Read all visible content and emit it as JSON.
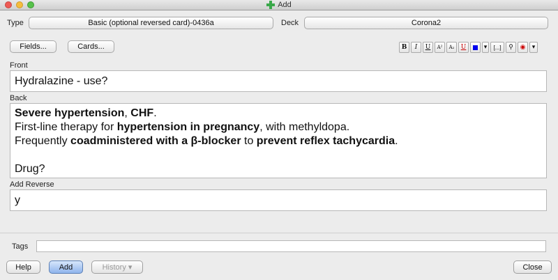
{
  "window": {
    "title": "Add"
  },
  "header": {
    "type_label": "Type",
    "type_value": "Basic (optional reversed card)-0436a",
    "deck_label": "Deck",
    "deck_value": "Corona2"
  },
  "buttons": {
    "fields": "Fields...",
    "cards": "Cards..."
  },
  "toolbar": {
    "bold": "B",
    "italic": "I",
    "underline": "U",
    "superscript": "A²",
    "subscript": "A₂",
    "clear_format": "U",
    "color_arrow": "▾",
    "cloze": "[...]",
    "attach": "⚲",
    "record": "◉",
    "more": "▾",
    "text_color": "#0000ee"
  },
  "fields": {
    "front": {
      "label": "Front",
      "value": "Hydralazine - use?"
    },
    "back": {
      "label": "Back",
      "line1_b1": "Severe hypertension",
      "line1_t1": ", ",
      "line1_b2": "CHF",
      "line1_t2": ".",
      "line2_t1": "First-line therapy for ",
      "line2_b1": "hypertension in pregnancy",
      "line2_t2": ", with methyldopa.",
      "line3_t1": "Frequently ",
      "line3_b1": "coadministered with a β-blocker",
      "line3_t2": " to ",
      "line3_b2": "prevent reflex tachycardia",
      "line3_t3": ".",
      "line5": "Drug?"
    },
    "add_reverse": {
      "label": "Add Reverse",
      "value": "y"
    }
  },
  "tags": {
    "label": "Tags",
    "value": ""
  },
  "footer": {
    "help": "Help",
    "add": "Add",
    "history": "History ▾",
    "close": "Close"
  }
}
